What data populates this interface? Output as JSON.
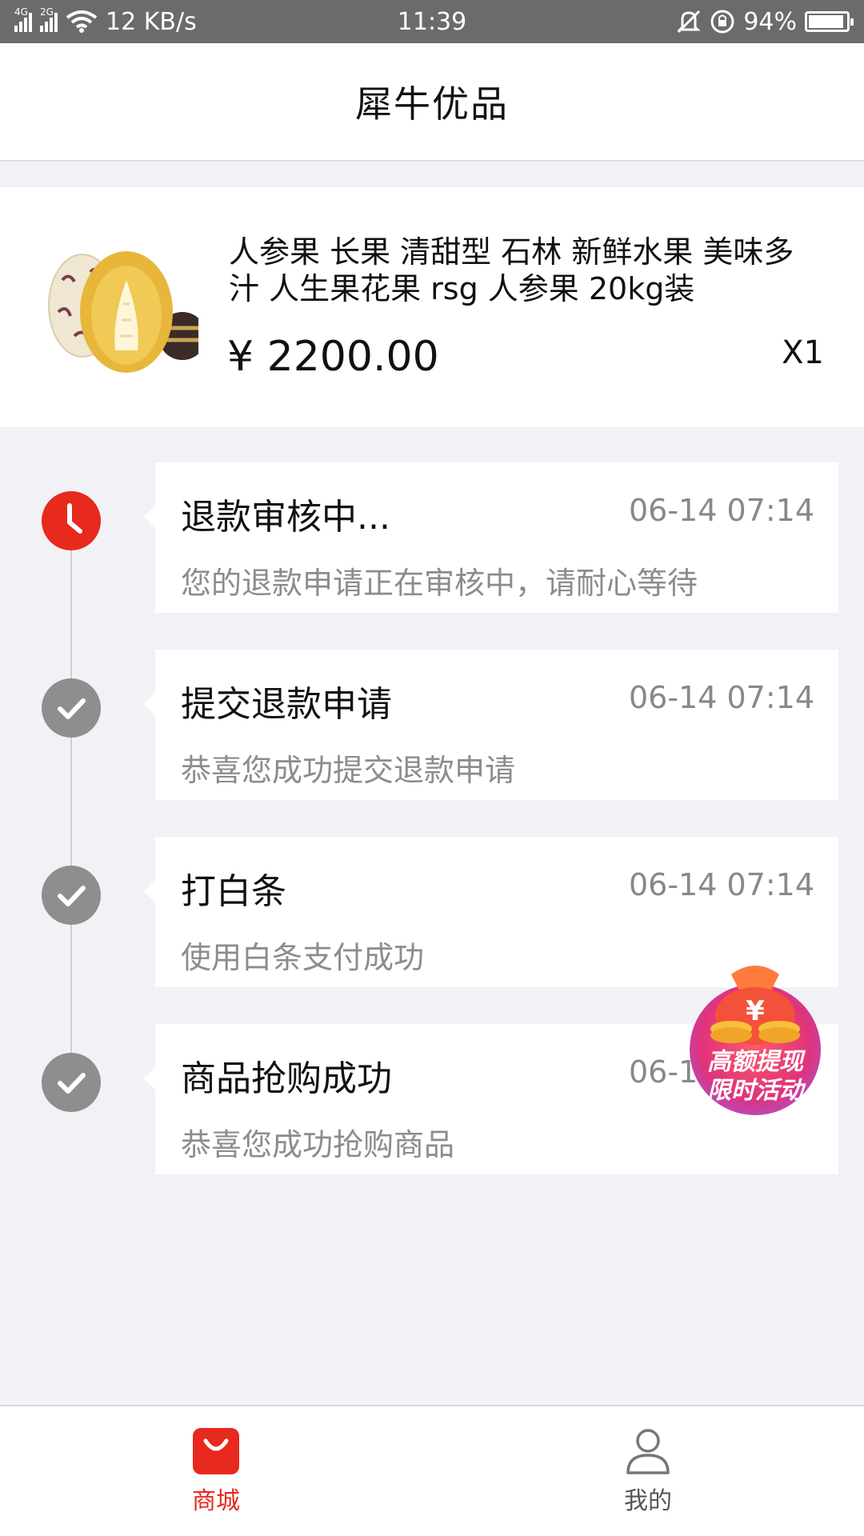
{
  "status_bar": {
    "network_1": "4G",
    "network_2": "2G",
    "speed": "12 KB/s",
    "time": "11:39",
    "battery": "94%",
    "battery_level": 0.94
  },
  "header": {
    "title": "犀牛优品"
  },
  "product": {
    "name": "人参果 长果 清甜型 石林 新鲜水果 美味多汁 人生果花果 rsg 人参果 20kg装",
    "price": "¥ 2200.00",
    "quantity": "X1"
  },
  "timeline": [
    {
      "title": "退款审核中...",
      "time": "06-14 07:14",
      "desc": "您的退款申请正在审核中，请耐心等待",
      "status": "pending",
      "icon": "clock-icon",
      "color": "#e8291d"
    },
    {
      "title": "提交退款申请",
      "time": "06-14 07:14",
      "desc": "恭喜您成功提交退款申请",
      "status": "done",
      "icon": "check-icon",
      "color": "#8e8e8e"
    },
    {
      "title": "打白条",
      "time": "06-14 07:14",
      "desc": "使用白条支付成功",
      "status": "done",
      "icon": "check-icon",
      "color": "#8e8e8e"
    },
    {
      "title": "商品抢购成功",
      "time": "06-14 07:14",
      "desc": "恭喜您成功抢购商品",
      "status": "done",
      "icon": "check-icon",
      "color": "#8e8e8e"
    }
  ],
  "promo": {
    "line1": "高额提现",
    "line2": "限时活动",
    "symbol": "¥"
  },
  "bottom_nav": [
    {
      "label": "商城",
      "icon": "shopping-bag-icon",
      "active": true
    },
    {
      "label": "我的",
      "icon": "user-icon",
      "active": false
    }
  ],
  "colors": {
    "accent": "#e8291d",
    "done": "#8e8e8e"
  }
}
